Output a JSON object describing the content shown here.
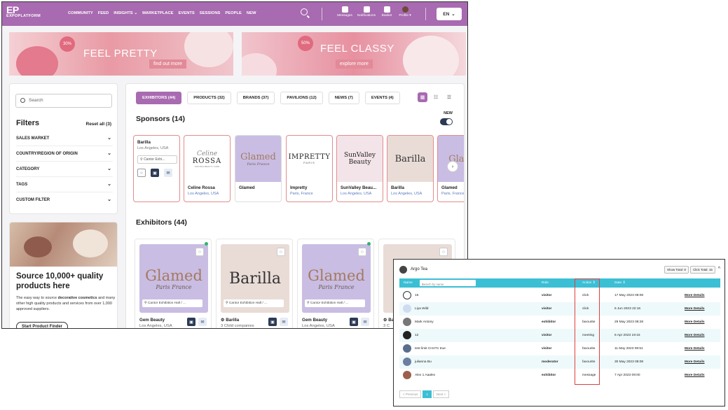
{
  "brand": {
    "logo": "EP",
    "name": "EXPOPLATFORM"
  },
  "nav": [
    "COMMUNITY",
    "FEED",
    "INSIGHTS ⌄",
    "MARKETPLACE",
    "EVENTS",
    "SESSIONS",
    "PEOPLE",
    "NEW"
  ],
  "top_icons": {
    "messages": "Messages",
    "notifications": "Notifications",
    "basket": "Basket",
    "profile": "Profile ▾"
  },
  "lang": "EN",
  "banners": [
    {
      "badge": "30%",
      "title": "FEEL PRETTY",
      "button": "find out more"
    },
    {
      "badge": "50%",
      "title": "FEEL CLASSY",
      "button": "explore more"
    }
  ],
  "sidebar": {
    "search_placeholder": "Search",
    "filters_title": "Filters",
    "reset": "Reset all (3)",
    "filters": [
      "SALES MARKET",
      "COUNTRY/REGION OF ORIGIN",
      "CATEGORY",
      "TAGS",
      "CUSTOM FILTER"
    ]
  },
  "promo": {
    "title": "Source 10,000+ quality products here",
    "text_pre": "The easy way to source ",
    "text_bold": "decorative cosmetics",
    "text_post": " and many other high quality products and services from over 1,000 approved suppliers.",
    "button": "Start Product Finder"
  },
  "tabs": [
    "EXHIBITORS (44)",
    "PRODUCTS (32)",
    "BRANDS (37)",
    "PAVILIONS (12)",
    "NEWS (7)",
    "EVENTS (4)"
  ],
  "sponsors_title": "Sponsors (14)",
  "new_label": "NEW",
  "sponsors": [
    {
      "name": "Barilla",
      "loc": "Los Angeles, USA",
      "addr": "Cantor Exhi..."
    },
    {
      "name": "Celine Rossa",
      "loc": "Los Angeles, USA",
      "logo_a": "Celine",
      "logo_b": "ROSSA",
      "logo_c": "NATURAL BEAUTY CARE"
    },
    {
      "name": "Glamed",
      "loc": "",
      "logo_a": "Glamed",
      "logo_b": "Paris France"
    },
    {
      "name": "Impretty",
      "loc": "Paris, France",
      "logo_a": "IMPRETTY",
      "logo_b": "PARIS"
    },
    {
      "name": "SunValley Beau...",
      "loc": "Los Angeles, USA",
      "logo_a": "SunValley",
      "logo_b": "Beauty"
    },
    {
      "name": "Barilla",
      "loc": "Los Angeles, USA",
      "logo_a": "Barilla"
    },
    {
      "name": "Glamed",
      "loc": "Paris, France",
      "logo_a": "Glam"
    }
  ],
  "exhibitors_title": "Exhibitors (44)",
  "exhibitors": [
    {
      "name": "Gem Beauty",
      "sub": "Los Angeles, USA",
      "loc": "Cantor Exhibition Hall / ...",
      "logo_a": "Glamed",
      "logo_b": "Paris France"
    },
    {
      "name": "Barilla",
      "sub": "3 Child companies",
      "loc": "Cantor Exhibition Hall / ...",
      "logo_a": "Barilla"
    },
    {
      "name": "Gem Beauty",
      "sub": "Los Angeles, USA",
      "loc": "Cantor Exhibition Hall / ...",
      "logo_a": "Glamed",
      "logo_b": "Paris France"
    },
    {
      "name": "Ba",
      "sub": "3 C",
      "loc": ""
    }
  ],
  "overlay": {
    "title": "Argo Tea",
    "show_total": "Show Total: 8",
    "click_total": "Click Total: 15",
    "columns": {
      "name": "Name",
      "search": "Search by name",
      "role": "Role",
      "action": "Action ⇕",
      "date": "Date ⇕"
    },
    "rows": [
      {
        "name": "15",
        "role": "visitor",
        "action": "click",
        "date": "17 May 2023 08:08",
        "link": "More Details"
      },
      {
        "name": "Liya Wild",
        "role": "visitor",
        "action": "click",
        "date": "6 Jun 2023 22:16",
        "link": "More Details"
      },
      {
        "name": "Mark Antony",
        "role": "exhibitor",
        "action": "favourite",
        "date": "29 May 2023 08:28",
        "link": "More Details"
      },
      {
        "name": "12",
        "role": "visitor",
        "action": "meeting",
        "date": "6 Apr 2023 19:15",
        "link": "More Details"
      },
      {
        "name": "test limit CHAT1 true",
        "role": "visitor",
        "action": "favourite",
        "date": "11 May 2023 08:51",
        "link": "More Details"
      },
      {
        "name": "julianna Bu",
        "role": "moderator",
        "action": "favourite",
        "date": "30 May 2023 08:08",
        "link": "More Details"
      },
      {
        "name": "Alex 1 Aaalex",
        "role": "exhibitor",
        "action": "message",
        "date": "7 Apr 2023 09:00",
        "link": "More Details"
      }
    ],
    "pager": {
      "prev": "< Previous",
      "page": "1",
      "next": "Next >"
    }
  }
}
